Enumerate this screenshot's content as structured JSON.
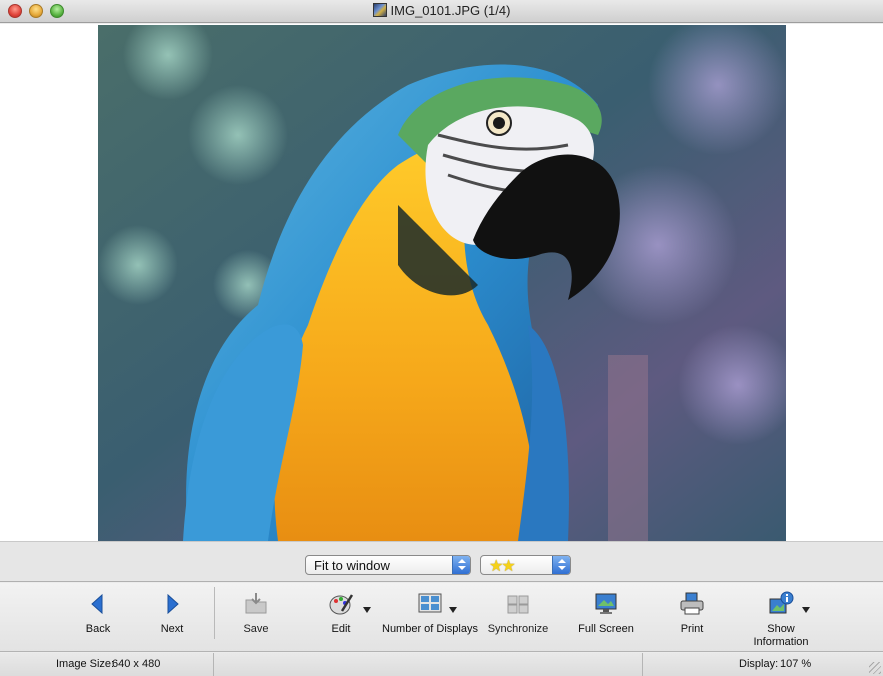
{
  "window": {
    "title": "IMG_0101.JPG (1/4)"
  },
  "viewer": {
    "fit_mode": "Fit to window",
    "rating_stars": 2,
    "rating_glyphs": "★★"
  },
  "toolbar": {
    "back": "Back",
    "next": "Next",
    "save": "Save",
    "edit": "Edit",
    "number_of_displays": "Number of Displays",
    "synchronize": "Synchronize",
    "full_screen": "Full Screen",
    "print": "Print",
    "show_information_line1": "Show",
    "show_information_line2": "Information"
  },
  "status": {
    "image_size_label": "Image Size:",
    "image_size_value": "640 x 480",
    "display_label": "Display:",
    "display_value": "107 %"
  },
  "colors": {
    "accent_blue": "#2f6fd3",
    "star_yellow": "#f5d11a"
  }
}
